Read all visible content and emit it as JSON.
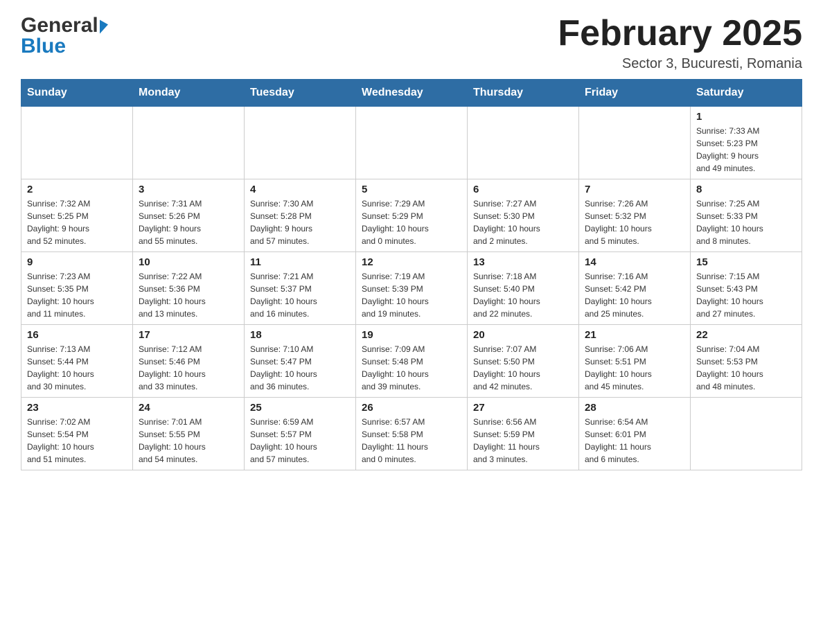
{
  "header": {
    "logo_general": "General",
    "logo_blue": "Blue",
    "month_title": "February 2025",
    "subtitle": "Sector 3, Bucuresti, Romania"
  },
  "days_of_week": [
    "Sunday",
    "Monday",
    "Tuesday",
    "Wednesday",
    "Thursday",
    "Friday",
    "Saturday"
  ],
  "weeks": [
    [
      {
        "day": "",
        "info": ""
      },
      {
        "day": "",
        "info": ""
      },
      {
        "day": "",
        "info": ""
      },
      {
        "day": "",
        "info": ""
      },
      {
        "day": "",
        "info": ""
      },
      {
        "day": "",
        "info": ""
      },
      {
        "day": "1",
        "info": "Sunrise: 7:33 AM\nSunset: 5:23 PM\nDaylight: 9 hours\nand 49 minutes."
      }
    ],
    [
      {
        "day": "2",
        "info": "Sunrise: 7:32 AM\nSunset: 5:25 PM\nDaylight: 9 hours\nand 52 minutes."
      },
      {
        "day": "3",
        "info": "Sunrise: 7:31 AM\nSunset: 5:26 PM\nDaylight: 9 hours\nand 55 minutes."
      },
      {
        "day": "4",
        "info": "Sunrise: 7:30 AM\nSunset: 5:28 PM\nDaylight: 9 hours\nand 57 minutes."
      },
      {
        "day": "5",
        "info": "Sunrise: 7:29 AM\nSunset: 5:29 PM\nDaylight: 10 hours\nand 0 minutes."
      },
      {
        "day": "6",
        "info": "Sunrise: 7:27 AM\nSunset: 5:30 PM\nDaylight: 10 hours\nand 2 minutes."
      },
      {
        "day": "7",
        "info": "Sunrise: 7:26 AM\nSunset: 5:32 PM\nDaylight: 10 hours\nand 5 minutes."
      },
      {
        "day": "8",
        "info": "Sunrise: 7:25 AM\nSunset: 5:33 PM\nDaylight: 10 hours\nand 8 minutes."
      }
    ],
    [
      {
        "day": "9",
        "info": "Sunrise: 7:23 AM\nSunset: 5:35 PM\nDaylight: 10 hours\nand 11 minutes."
      },
      {
        "day": "10",
        "info": "Sunrise: 7:22 AM\nSunset: 5:36 PM\nDaylight: 10 hours\nand 13 minutes."
      },
      {
        "day": "11",
        "info": "Sunrise: 7:21 AM\nSunset: 5:37 PM\nDaylight: 10 hours\nand 16 minutes."
      },
      {
        "day": "12",
        "info": "Sunrise: 7:19 AM\nSunset: 5:39 PM\nDaylight: 10 hours\nand 19 minutes."
      },
      {
        "day": "13",
        "info": "Sunrise: 7:18 AM\nSunset: 5:40 PM\nDaylight: 10 hours\nand 22 minutes."
      },
      {
        "day": "14",
        "info": "Sunrise: 7:16 AM\nSunset: 5:42 PM\nDaylight: 10 hours\nand 25 minutes."
      },
      {
        "day": "15",
        "info": "Sunrise: 7:15 AM\nSunset: 5:43 PM\nDaylight: 10 hours\nand 27 minutes."
      }
    ],
    [
      {
        "day": "16",
        "info": "Sunrise: 7:13 AM\nSunset: 5:44 PM\nDaylight: 10 hours\nand 30 minutes."
      },
      {
        "day": "17",
        "info": "Sunrise: 7:12 AM\nSunset: 5:46 PM\nDaylight: 10 hours\nand 33 minutes."
      },
      {
        "day": "18",
        "info": "Sunrise: 7:10 AM\nSunset: 5:47 PM\nDaylight: 10 hours\nand 36 minutes."
      },
      {
        "day": "19",
        "info": "Sunrise: 7:09 AM\nSunset: 5:48 PM\nDaylight: 10 hours\nand 39 minutes."
      },
      {
        "day": "20",
        "info": "Sunrise: 7:07 AM\nSunset: 5:50 PM\nDaylight: 10 hours\nand 42 minutes."
      },
      {
        "day": "21",
        "info": "Sunrise: 7:06 AM\nSunset: 5:51 PM\nDaylight: 10 hours\nand 45 minutes."
      },
      {
        "day": "22",
        "info": "Sunrise: 7:04 AM\nSunset: 5:53 PM\nDaylight: 10 hours\nand 48 minutes."
      }
    ],
    [
      {
        "day": "23",
        "info": "Sunrise: 7:02 AM\nSunset: 5:54 PM\nDaylight: 10 hours\nand 51 minutes."
      },
      {
        "day": "24",
        "info": "Sunrise: 7:01 AM\nSunset: 5:55 PM\nDaylight: 10 hours\nand 54 minutes."
      },
      {
        "day": "25",
        "info": "Sunrise: 6:59 AM\nSunset: 5:57 PM\nDaylight: 10 hours\nand 57 minutes."
      },
      {
        "day": "26",
        "info": "Sunrise: 6:57 AM\nSunset: 5:58 PM\nDaylight: 11 hours\nand 0 minutes."
      },
      {
        "day": "27",
        "info": "Sunrise: 6:56 AM\nSunset: 5:59 PM\nDaylight: 11 hours\nand 3 minutes."
      },
      {
        "day": "28",
        "info": "Sunrise: 6:54 AM\nSunset: 6:01 PM\nDaylight: 11 hours\nand 6 minutes."
      },
      {
        "day": "",
        "info": ""
      }
    ]
  ]
}
